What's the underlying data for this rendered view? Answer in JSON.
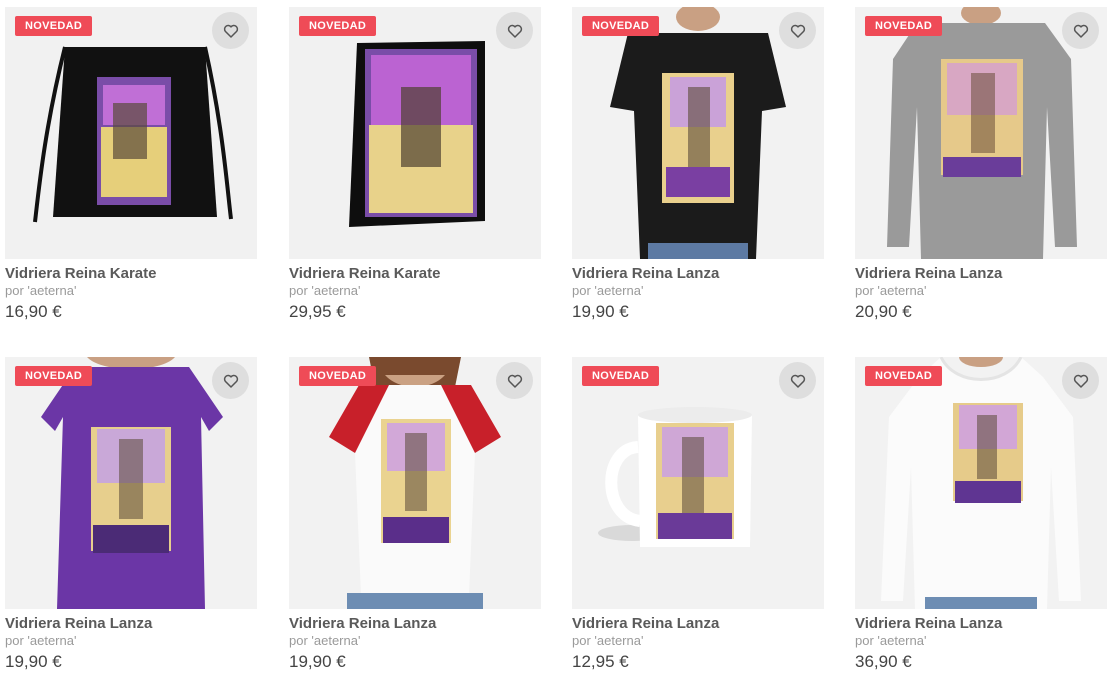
{
  "products": [
    {
      "badge": "NOVEDAD",
      "title": "Vidriera Reina Karate",
      "author": "por 'aeterna'",
      "price": "16,90 €",
      "kind": "drawstring-bag"
    },
    {
      "badge": "NOVEDAD",
      "title": "Vidriera Reina Karate",
      "author": "por 'aeterna'",
      "price": "29,95 €",
      "kind": "canvas-print"
    },
    {
      "badge": "NOVEDAD",
      "title": "Vidriera Reina Lanza",
      "author": "por 'aeterna'",
      "price": "19,90 €",
      "kind": "black-tshirt"
    },
    {
      "badge": "NOVEDAD",
      "title": "Vidriera Reina Lanza",
      "author": "por 'aeterna'",
      "price": "20,90 €",
      "kind": "grey-longsleeve"
    },
    {
      "badge": "NOVEDAD",
      "title": "Vidriera Reina Lanza",
      "author": "por 'aeterna'",
      "price": "19,90 €",
      "kind": "purple-tshirt"
    },
    {
      "badge": "NOVEDAD",
      "title": "Vidriera Reina Lanza",
      "author": "por 'aeterna'",
      "price": "19,90 €",
      "kind": "raglan-tshirt"
    },
    {
      "badge": "NOVEDAD",
      "title": "Vidriera Reina Lanza",
      "author": "por 'aeterna'",
      "price": "12,95 €",
      "kind": "mug"
    },
    {
      "badge": "NOVEDAD",
      "title": "Vidriera Reina Lanza",
      "author": "por 'aeterna'",
      "price": "36,90 €",
      "kind": "white-hoodie"
    }
  ],
  "icons": {
    "favorite": "heart-outline-icon"
  }
}
